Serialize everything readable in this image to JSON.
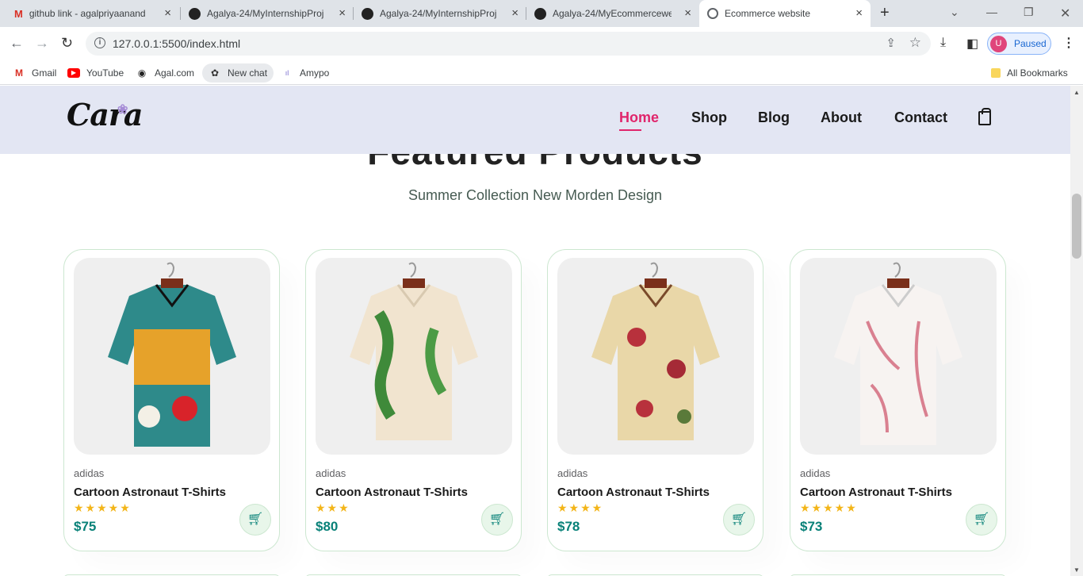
{
  "browser": {
    "tabs": [
      {
        "title": "github link - agalpriyaanand",
        "icon": "gmail-icon"
      },
      {
        "title": "Agalya-24/MyInternshipProj",
        "icon": "github-icon"
      },
      {
        "title": "Agalya-24/MyInternshipProj",
        "icon": "github-icon"
      },
      {
        "title": "Agalya-24/MyEcommercewe",
        "icon": "github-icon"
      },
      {
        "title": "Ecommerce website",
        "icon": "globe-icon",
        "active": true
      }
    ],
    "url": "127.0.0.1:5500/index.html",
    "profile_initial": "U",
    "profile_status": "Paused",
    "bookmarks": [
      {
        "label": "Gmail",
        "icon": "gmail-icon"
      },
      {
        "label": "YouTube",
        "icon": "youtube-icon"
      },
      {
        "label": "Agal.com",
        "icon": "globe-icon"
      },
      {
        "label": "New chat",
        "icon": "chatgpt-icon"
      },
      {
        "label": "Amypo",
        "icon": "amypo-icon"
      }
    ],
    "all_bookmarks": "All Bookmarks"
  },
  "site": {
    "logo": "Cara",
    "nav": [
      {
        "label": "Home",
        "active": true
      },
      {
        "label": "Shop"
      },
      {
        "label": "Blog"
      },
      {
        "label": "About"
      },
      {
        "label": "Contact"
      }
    ],
    "section_title": "Featured Products",
    "section_subtitle": "Summer Collection New Morden Design",
    "products": [
      {
        "brand": "adidas",
        "name": "Cartoon Astronaut T-Shirts",
        "rating": 5,
        "stars": "★★★★★",
        "price": "$75"
      },
      {
        "brand": "adidas",
        "name": "Cartoon Astronaut T-Shirts",
        "rating": 3,
        "stars": "★★★",
        "price": "$80"
      },
      {
        "brand": "adidas",
        "name": "Cartoon Astronaut T-Shirts",
        "rating": 4,
        "stars": "★★★★",
        "price": "$78"
      },
      {
        "brand": "adidas",
        "name": "Cartoon Astronaut T-Shirts",
        "rating": 5,
        "stars": "★★★★★",
        "price": "$73"
      }
    ]
  },
  "colors": {
    "accent": "#088178",
    "nav_active": "#e0256b",
    "header_bg": "#e3e6f3",
    "star": "#f3b519"
  }
}
